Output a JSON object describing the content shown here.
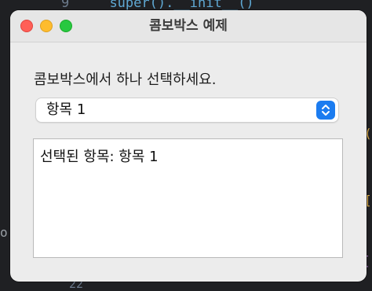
{
  "background": {
    "code_top": "super().__init__()",
    "code_top_line_number": "9",
    "code_bottom": "22",
    "code_left": "o",
    "code_right_1": "(",
    "code_right_2": "[",
    "code_right_3": "["
  },
  "window": {
    "title": "콤보박스 예제",
    "prompt": "콤보박스에서 하나 선택하세요.",
    "combobox": {
      "selected": "항목 1"
    },
    "textarea": {
      "text": "선택된 항목: 항목 1"
    }
  },
  "colors": {
    "close": "#ff5f57",
    "minimize": "#febc2e",
    "maximize": "#28c840",
    "accent": "#1b7cf0"
  }
}
